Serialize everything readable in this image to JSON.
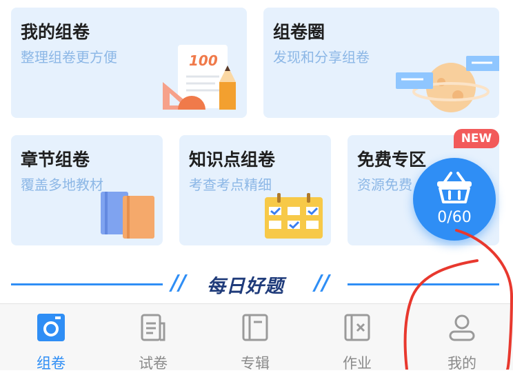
{
  "cards": [
    {
      "title": "我的组卷",
      "subtitle": "整理组卷更方便",
      "illustration": "test-paper-100-icon"
    },
    {
      "title": "组卷圈",
      "subtitle": "发现和分享组卷",
      "illustration": "planet-chat-icon"
    },
    {
      "title": "章节组卷",
      "subtitle": "覆盖多地教材",
      "illustration": "books-icon"
    },
    {
      "title": "知识点组卷",
      "subtitle": "考查考点精细",
      "illustration": "calendar-check-icon"
    },
    {
      "title": "免费专区",
      "subtitle": "资源免费"
    }
  ],
  "badge": {
    "label": "NEW",
    "color": "#f25a5a"
  },
  "basket": {
    "count": "0/60",
    "icon": "basket-icon"
  },
  "section": {
    "title": "每日好题"
  },
  "tabs": [
    {
      "label": "组卷",
      "icon": "camera-icon",
      "active": true
    },
    {
      "label": "试卷",
      "icon": "paper-icon"
    },
    {
      "label": "专辑",
      "icon": "album-icon"
    },
    {
      "label": "作业",
      "icon": "homework-icon"
    },
    {
      "label": "我的",
      "icon": "user-icon"
    }
  ],
  "colors": {
    "accent": "#2f8ef5",
    "card_bg": "#e6f1fd",
    "annotation": "#e8382e"
  }
}
